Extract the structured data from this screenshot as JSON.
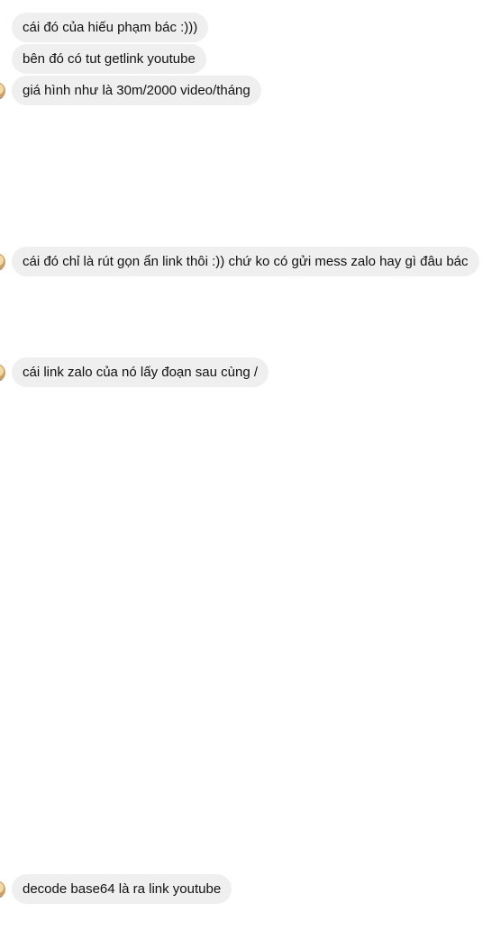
{
  "messages": [
    {
      "text": "cái đó của hiếu phạm bác :)))",
      "avatar": false
    },
    {
      "text": "bên đó có tut getlink youtube",
      "avatar": false
    },
    {
      "text": "giá hình như là 30m/2000 video/tháng",
      "avatar": true
    },
    {
      "text": "cái đó chỉ là rút gọn ẩn link thôi :)) chứ ko có gửi mess zalo hay gì đâu bác",
      "avatar": true
    },
    {
      "text": "cái link zalo của nó lấy đoạn sau cùng /",
      "avatar": true
    },
    {
      "text": "decode base64 là ra link youtube",
      "avatar": true
    }
  ]
}
